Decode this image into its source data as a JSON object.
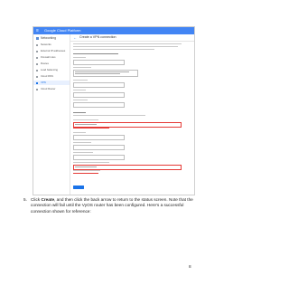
{
  "console": {
    "brand": "Google Cloud Platform",
    "sidebar_title": "Networking",
    "sidebar_items": [
      {
        "label": "Networks",
        "active": false
      },
      {
        "label": "External IP addresses",
        "active": false
      },
      {
        "label": "Firewall rules",
        "active": false
      },
      {
        "label": "Routes",
        "active": false
      },
      {
        "label": "Load balancing",
        "active": false
      },
      {
        "label": "Cloud DNS",
        "active": false
      },
      {
        "label": "VPN",
        "active": true
      },
      {
        "label": "Cloud Router",
        "active": false
      }
    ],
    "back_arrow": "←",
    "page_title": "Create a VPN connection"
  },
  "step": {
    "number": "5.",
    "text_before": "Click ",
    "bold": "Create",
    "text_after": ", and then click the back arrow to return to the status screen. Note that the connection will fail until the VyOS router has been configured. Here’s a successful connection shown for reference:"
  },
  "page_number": "8",
  "colors": {
    "gcp_blue": "#4285f4",
    "accent": "#1a73e8",
    "error_red": "#e53935"
  }
}
